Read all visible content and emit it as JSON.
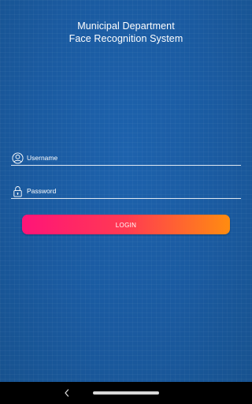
{
  "app": {
    "title_line1": "Municipal Department",
    "title_line2": "Face Recognition System"
  },
  "login_form": {
    "username_placeholder": "Username",
    "password_placeholder": "Password",
    "login_label": "LOGIN",
    "username_icon": "user-circle-icon",
    "password_icon": "lock-icon"
  },
  "system_nav": {
    "back_icon": "chevron-left-icon",
    "home_icon": "home-pill"
  },
  "colors": {
    "background": "#1a5aa0",
    "button_gradient_start": "#ff1478",
    "button_gradient_end": "#ff8c10",
    "text": "#ffffff",
    "navbar": "#000000"
  }
}
